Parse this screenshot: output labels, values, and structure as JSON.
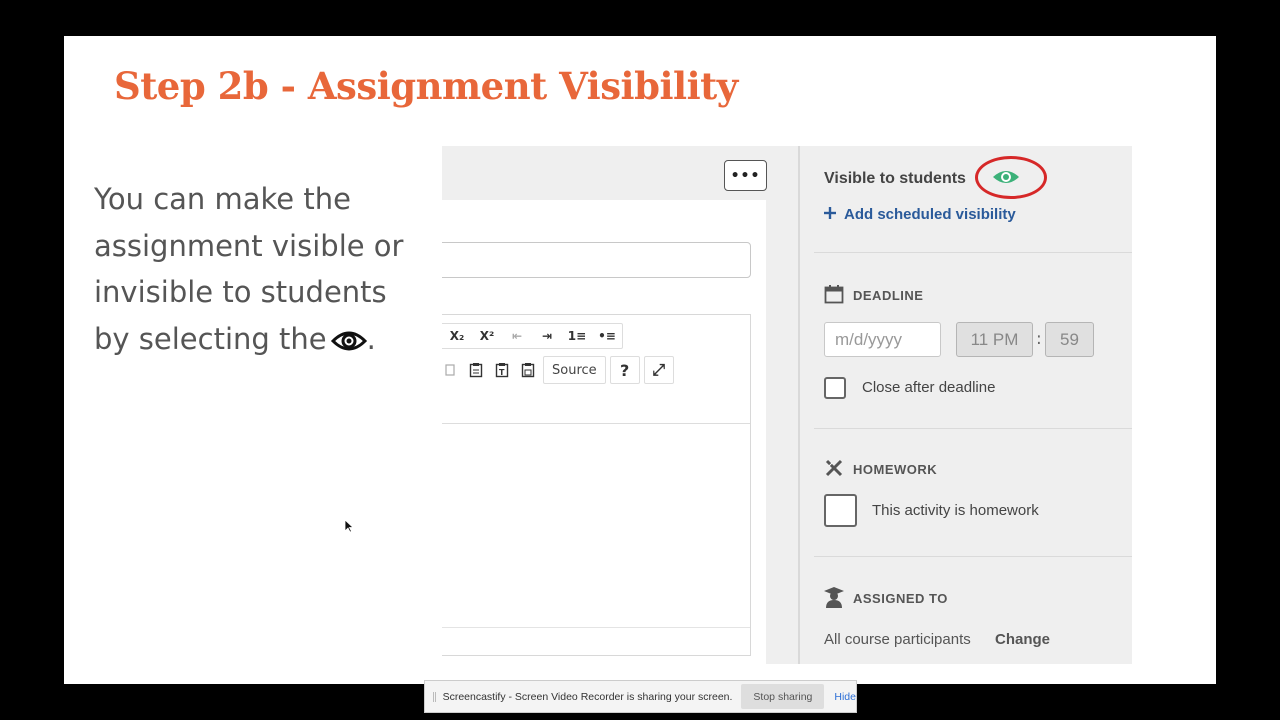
{
  "slide": {
    "title": "Step 2b - Assignment Visibility",
    "body_lines": [
      "You can make the",
      "assignment visible or",
      "invisible to students",
      "by selecting the"
    ],
    "body_end": "."
  },
  "editor": {
    "more_label": "•••",
    "toolbar_row1": [
      "X₂",
      "X²",
      "⇤",
      "⇥",
      "1≡",
      "•≡"
    ],
    "source_label": "Source",
    "help_label": "?",
    "maximize_label": "⤢"
  },
  "sidebar": {
    "visible_label": "Visible to students",
    "add_scheduled": "Add scheduled visibility",
    "deadline": {
      "heading": "DEADLINE",
      "date_placeholder": "m/d/yyyy",
      "hour": "11 PM",
      "colon": ":",
      "minute": "59",
      "close_label": "Close after deadline"
    },
    "homework": {
      "heading": "HOMEWORK",
      "checkbox_label": "This activity is homework"
    },
    "assigned": {
      "heading": "ASSIGNED TO",
      "value": "All course participants",
      "change": "Change"
    }
  },
  "share_bar": {
    "message": "Screencastify - Screen Video Recorder is sharing your screen.",
    "stop": "Stop sharing",
    "hide": "Hide"
  },
  "colors": {
    "title": "#e8673a",
    "eye_green": "#3cb179",
    "highlight_circle": "#d62828",
    "link_blue": "#2a5a9a"
  }
}
